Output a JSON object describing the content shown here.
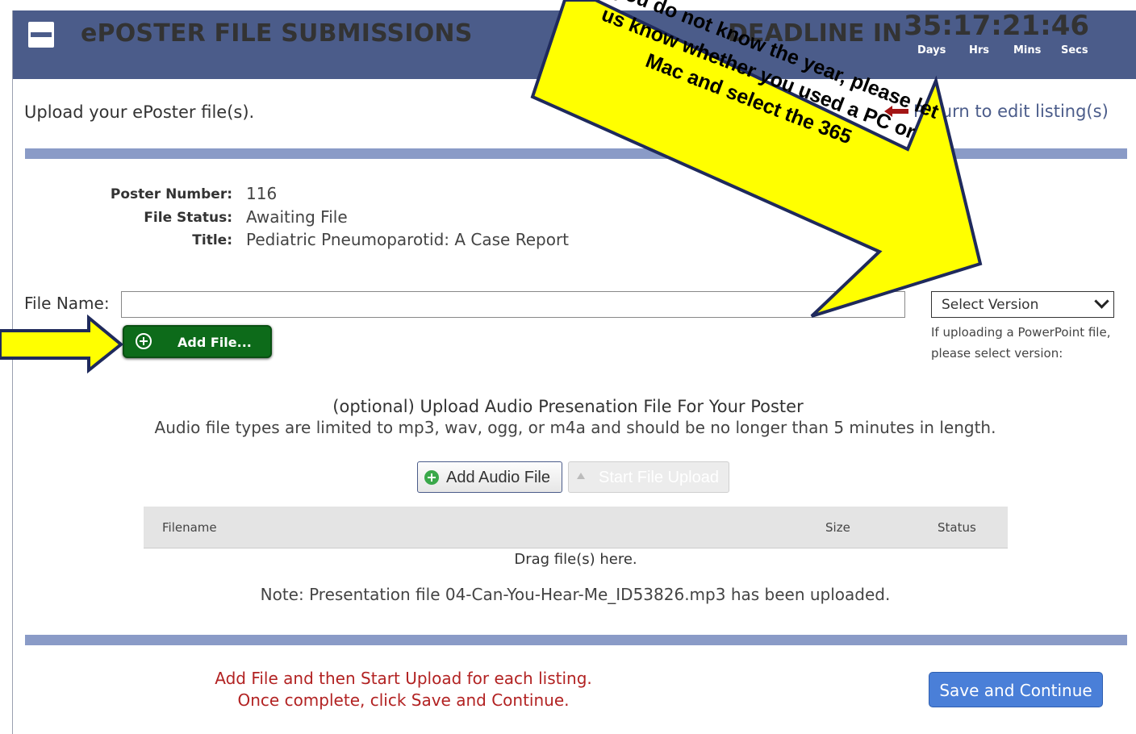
{
  "header": {
    "title": "ePOSTER FILE SUBMISSIONS",
    "deadline_label": "DEADLINE IN",
    "countdown": "35:17:21:46",
    "units": {
      "days": "Days",
      "hrs": "Hrs",
      "mins": "Mins",
      "secs": "Secs"
    }
  },
  "page": {
    "heading": "Upload your ePoster file(s).",
    "return_link": "Return to edit listing(s)"
  },
  "poster": {
    "number_label": "Poster Number:",
    "number": "116",
    "status_label": "File Status:",
    "status": "Awaiting File",
    "title_label": "Title:",
    "title": "Pediatric Pneumoparotid: A Case Report"
  },
  "file": {
    "name_label": "File Name:",
    "name_value": "",
    "add_file_label": "Add File...",
    "version_selected": "Select Version",
    "version_help": "If uploading a PowerPoint file, please select version:"
  },
  "audio": {
    "title": "(optional) Upload Audio Presenation File For Your Poster",
    "description": "Audio file types are limited to mp3, wav, ogg, or m4a and should be no longer than 5 minutes in length.",
    "add_label": "Add Audio File",
    "start_label": "Start File Upload",
    "columns": {
      "filename": "Filename",
      "size": "Size",
      "status": "Status"
    },
    "drop_text": "Drag file(s) here.",
    "note": "Note: Presentation file 04-Can-You-Hear-Me_ID53826.mp3 has been uploaded."
  },
  "footer": {
    "instruction_1": "Add File and then Start Upload for each listing.",
    "instruction_2": "Once complete, click Save and Continue.",
    "save_label": "Save and Continue"
  },
  "callout": {
    "line_1": "If you do not know the year, please let",
    "line_2": "us know whether you used a PC or",
    "line_3": "Mac and select the 365"
  },
  "colors": {
    "header_bg": "#4b5c8a",
    "divider": "#8a9bc7",
    "add_file_green": "#0d6b1a",
    "callout_yellow": "#ffff00",
    "callout_border": "#1f2a5c",
    "instruction_red": "#b22222",
    "save_blue": "#4a7fd8"
  }
}
